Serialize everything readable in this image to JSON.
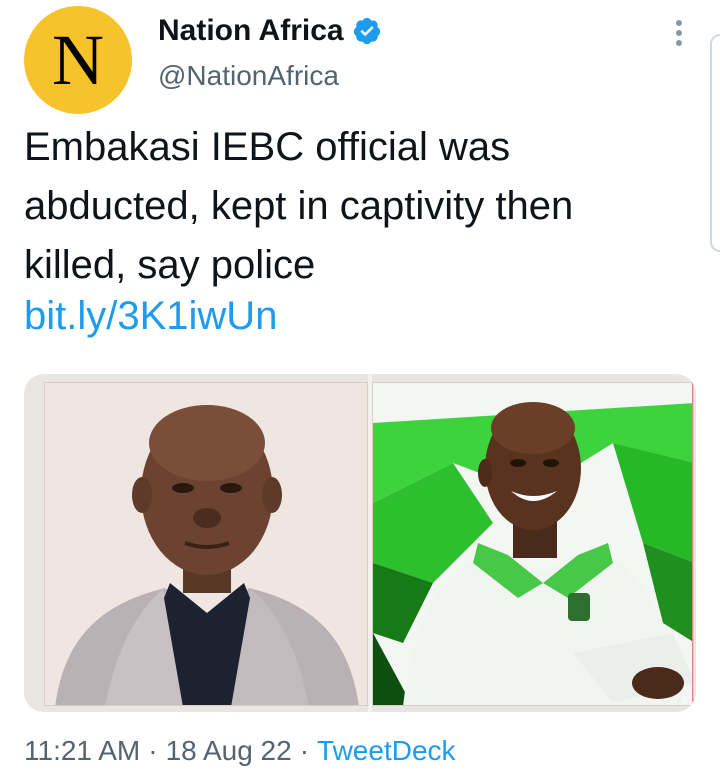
{
  "account": {
    "avatar_letter": "N",
    "display_name": "Nation Africa",
    "handle": "@NationAfrica",
    "verified": true,
    "avatar_color": "#f7c32a",
    "verified_color": "#1d9bf0"
  },
  "tweet": {
    "lines": [
      "Embakasi IEBC official was",
      "abducted, kept in captivity then",
      "killed, say police"
    ],
    "link": "bit.ly/3K1iwUn"
  },
  "media": {
    "icons": [
      "photo-left-portrait-icon",
      "photo-right-portrait-icon"
    ]
  },
  "meta": {
    "time": "11:21 AM",
    "date": "18 Aug 22",
    "source": "TweetDeck",
    "separator": "·"
  },
  "colors": {
    "link": "#1d9bf0",
    "muted": "#536471",
    "text": "#0f1419"
  }
}
